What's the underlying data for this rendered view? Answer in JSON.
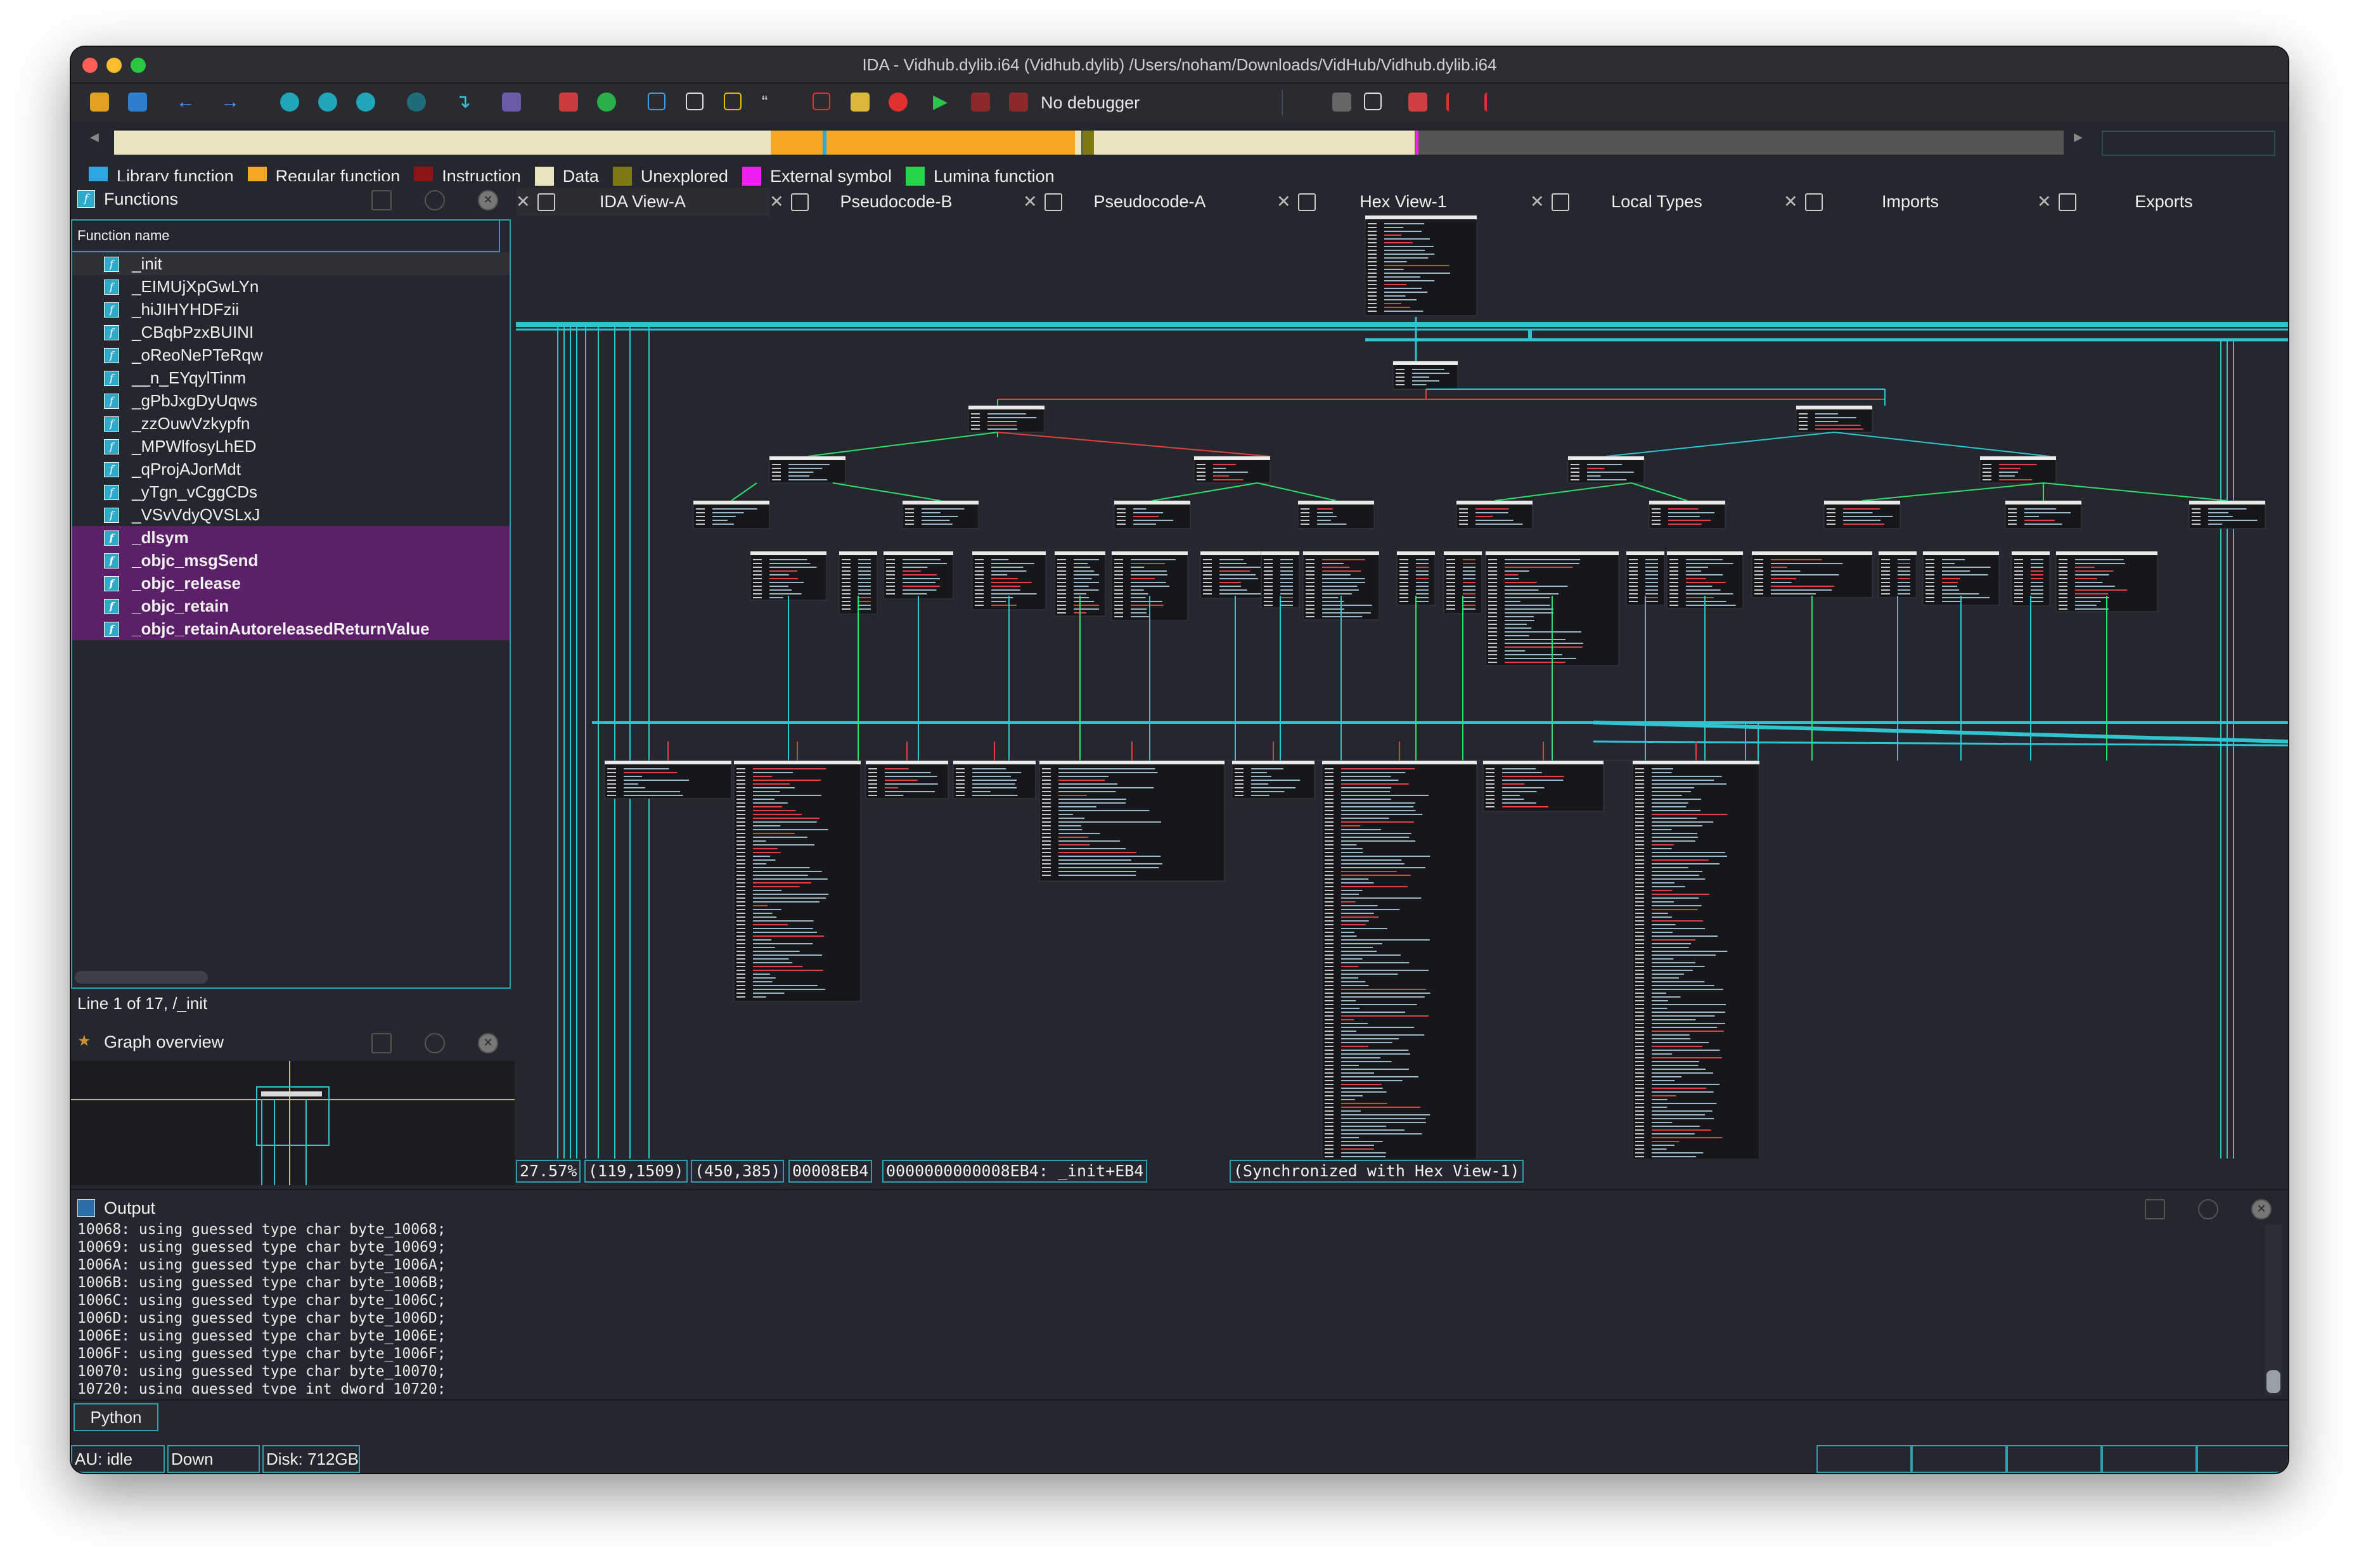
{
  "window": {
    "title": "IDA - Vidhub.dylib.i64 (Vidhub.dylib) /Users/noham/Downloads/VidHub/Vidhub.dylib.i64"
  },
  "toolbar": {
    "debugger": "No debugger"
  },
  "legend": [
    {
      "label": "Library function",
      "color": "#29a9e0"
    },
    {
      "label": "Regular function",
      "color": "#f5a623"
    },
    {
      "label": "Instruction",
      "color": "#8b1414"
    },
    {
      "label": "Data",
      "color": "#e9e4be"
    },
    {
      "label": "Unexplored",
      "color": "#7d7a14"
    },
    {
      "label": "External symbol",
      "color": "#f01ef0"
    },
    {
      "label": "Lumina function",
      "color": "#26d44a"
    }
  ],
  "functions_panel": {
    "title": "Functions",
    "column_header": "Function name",
    "items": [
      {
        "name": "_init",
        "kind": "regular"
      },
      {
        "name": "_EIMUjXpGwLYn",
        "kind": "regular"
      },
      {
        "name": "_hiJIHYHDFzii",
        "kind": "regular"
      },
      {
        "name": "_CBqbPzxBUINI",
        "kind": "regular"
      },
      {
        "name": "_oReoNePTeRqw",
        "kind": "regular"
      },
      {
        "name": "__n_EYqylTinm",
        "kind": "regular"
      },
      {
        "name": "_gPbJxgDyUqws",
        "kind": "regular"
      },
      {
        "name": "_zzOuwVzkypfn",
        "kind": "regular"
      },
      {
        "name": "_MPWlfosyLhED",
        "kind": "regular"
      },
      {
        "name": "_qProjAJorMdt",
        "kind": "regular"
      },
      {
        "name": "_yTgn_vCggCDs",
        "kind": "regular"
      },
      {
        "name": "_VSvVdyQVSLxJ",
        "kind": "regular"
      },
      {
        "name": "_dlsym",
        "kind": "import"
      },
      {
        "name": "_objc_msgSend",
        "kind": "import"
      },
      {
        "name": "_objc_release",
        "kind": "import"
      },
      {
        "name": "_objc_retain",
        "kind": "import"
      },
      {
        "name": "_objc_retainAutoreleasedReturnValue",
        "kind": "import"
      }
    ],
    "line_info": "Line 1 of 17, /_init"
  },
  "graph_overview": {
    "title": "Graph overview"
  },
  "tabs": [
    {
      "label": "IDA View-A",
      "active": true
    },
    {
      "label": "Pseudocode-B"
    },
    {
      "label": "Pseudocode-A"
    },
    {
      "label": "Hex View-1"
    },
    {
      "label": "Local Types"
    },
    {
      "label": "Imports"
    },
    {
      "label": "Exports"
    }
  ],
  "graph_status": {
    "zoom": "27.57%",
    "coords": "(119,1509)",
    "pos": "(450,385)",
    "offset": "00008EB4",
    "address": "0000000000008EB4: _init+EB4",
    "sync": "(Synchronized with Hex View-1)"
  },
  "output_panel": {
    "title": "Output",
    "lines": [
      "10068: using guessed type char byte_10068;",
      "10069: using guessed type char byte_10069;",
      "1006A: using guessed type char byte_1006A;",
      "1006B: using guessed type char byte_1006B;",
      "1006C: using guessed type char byte_1006C;",
      "1006D: using guessed type char byte_1006D;",
      "1006E: using guessed type char byte_1006E;",
      "1006F: using guessed type char byte_1006F;",
      "10070: using guessed type char byte_10070;",
      "10720: using guessed type int dword_10720;"
    ],
    "input_mode": "Python"
  },
  "statusbar": {
    "au": "AU:  idle",
    "direction": "Down",
    "disk": "Disk: 712GB"
  }
}
